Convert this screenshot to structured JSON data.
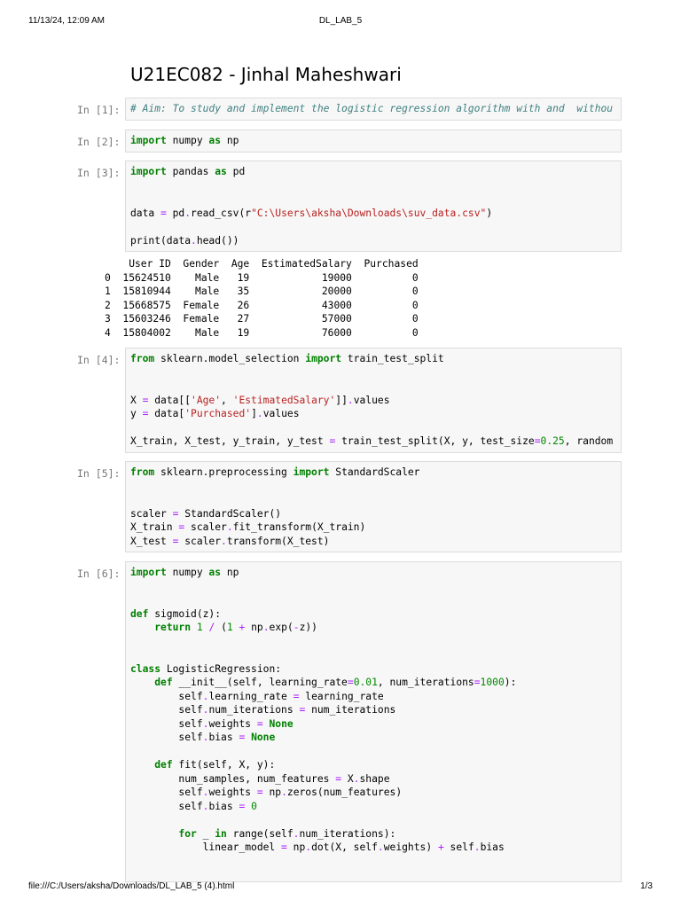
{
  "header": {
    "datetime": "11/13/24, 12:09 AM",
    "doc_title": "DL_LAB_5"
  },
  "footer": {
    "path": "file:///C:/Users/aksha/Downloads/DL_LAB_5 (4).html",
    "page": "1/3"
  },
  "title": "U21EC082 - Jinhal Maheshwari",
  "cells": [
    {
      "prompt": "In [1]:",
      "lines": [
        [
          [
            "c",
            "# Aim: To study and implement the logistic regression algorithm with and  withou"
          ]
        ]
      ]
    },
    {
      "prompt": "In [2]:",
      "lines": [
        [
          [
            "k",
            "import"
          ],
          [
            "p",
            " numpy "
          ],
          [
            "k",
            "as"
          ],
          [
            "p",
            " np"
          ]
        ]
      ]
    },
    {
      "prompt": "In [3]:",
      "lines": [
        [
          [
            "k",
            "import"
          ],
          [
            "p",
            " pandas "
          ],
          [
            "k",
            "as"
          ],
          [
            "p",
            " pd"
          ]
        ],
        [],
        [],
        [
          [
            "p",
            "data "
          ],
          [
            "o",
            "="
          ],
          [
            "p",
            " pd"
          ],
          [
            "o",
            "."
          ],
          [
            "p",
            "read_csv(r"
          ],
          [
            "s",
            "\"C:\\Users\\aksha\\Downloads\\suv_data.csv\""
          ],
          [
            "p",
            ")"
          ]
        ],
        [],
        [
          [
            "p",
            "print(data"
          ],
          [
            "o",
            "."
          ],
          [
            "p",
            "head())"
          ]
        ]
      ],
      "output": [
        "    User ID  Gender  Age  EstimatedSalary  Purchased",
        "0  15624510    Male   19            19000          0",
        "1  15810944    Male   35            20000          0",
        "2  15668575  Female   26            43000          0",
        "3  15603246  Female   27            57000          0",
        "4  15804002    Male   19            76000          0"
      ]
    },
    {
      "prompt": "In [4]:",
      "lines": [
        [
          [
            "k",
            "from"
          ],
          [
            "p",
            " sklearn.model_selection "
          ],
          [
            "k",
            "import"
          ],
          [
            "p",
            " train_test_split"
          ]
        ],
        [],
        [],
        [
          [
            "p",
            "X "
          ],
          [
            "o",
            "="
          ],
          [
            "p",
            " data[["
          ],
          [
            "s",
            "'Age'"
          ],
          [
            "p",
            ", "
          ],
          [
            "s",
            "'EstimatedSalary'"
          ],
          [
            "p",
            "]]"
          ],
          [
            "o",
            "."
          ],
          [
            "p",
            "values"
          ]
        ],
        [
          [
            "p",
            "y "
          ],
          [
            "o",
            "="
          ],
          [
            "p",
            " data["
          ],
          [
            "s",
            "'Purchased'"
          ],
          [
            "p",
            "]"
          ],
          [
            "o",
            "."
          ],
          [
            "p",
            "values"
          ]
        ],
        [],
        [
          [
            "p",
            "X_train, X_test, y_train, y_test "
          ],
          [
            "o",
            "="
          ],
          [
            "p",
            " train_test_split(X, y, test_size"
          ],
          [
            "o",
            "="
          ],
          [
            "n",
            "0.25"
          ],
          [
            "p",
            ", random"
          ]
        ]
      ]
    },
    {
      "prompt": "In [5]:",
      "lines": [
        [
          [
            "k",
            "from"
          ],
          [
            "p",
            " sklearn.preprocessing "
          ],
          [
            "k",
            "import"
          ],
          [
            "p",
            " StandardScaler"
          ]
        ],
        [],
        [],
        [
          [
            "p",
            "scaler "
          ],
          [
            "o",
            "="
          ],
          [
            "p",
            " StandardScaler()"
          ]
        ],
        [
          [
            "p",
            "X_train "
          ],
          [
            "o",
            "="
          ],
          [
            "p",
            " scaler"
          ],
          [
            "o",
            "."
          ],
          [
            "p",
            "fit_transform(X_train)"
          ]
        ],
        [
          [
            "p",
            "X_test "
          ],
          [
            "o",
            "="
          ],
          [
            "p",
            " scaler"
          ],
          [
            "o",
            "."
          ],
          [
            "p",
            "transform(X_test)"
          ]
        ]
      ]
    },
    {
      "prompt": "In [6]:",
      "lines": [
        [
          [
            "k",
            "import"
          ],
          [
            "p",
            " numpy "
          ],
          [
            "k",
            "as"
          ],
          [
            "p",
            " np"
          ]
        ],
        [],
        [],
        [
          [
            "k",
            "def"
          ],
          [
            "p",
            " sigmoid(z):"
          ]
        ],
        [
          [
            "p",
            "    "
          ],
          [
            "k",
            "return"
          ],
          [
            "p",
            " "
          ],
          [
            "n",
            "1"
          ],
          [
            "p",
            " "
          ],
          [
            "o",
            "/"
          ],
          [
            "p",
            " ("
          ],
          [
            "n",
            "1"
          ],
          [
            "p",
            " "
          ],
          [
            "o",
            "+"
          ],
          [
            "p",
            " np"
          ],
          [
            "o",
            "."
          ],
          [
            "p",
            "exp("
          ],
          [
            "o",
            "-"
          ],
          [
            "p",
            "z))"
          ]
        ],
        [],
        [],
        [
          [
            "k",
            "class"
          ],
          [
            "p",
            " LogisticRegression:"
          ]
        ],
        [
          [
            "p",
            "    "
          ],
          [
            "k",
            "def"
          ],
          [
            "p",
            " __init__(self, learning_rate"
          ],
          [
            "o",
            "="
          ],
          [
            "n",
            "0.01"
          ],
          [
            "p",
            ", num_iterations"
          ],
          [
            "o",
            "="
          ],
          [
            "n",
            "1000"
          ],
          [
            "p",
            "):"
          ]
        ],
        [
          [
            "p",
            "        self"
          ],
          [
            "o",
            "."
          ],
          [
            "p",
            "learning_rate "
          ],
          [
            "o",
            "="
          ],
          [
            "p",
            " learning_rate"
          ]
        ],
        [
          [
            "p",
            "        self"
          ],
          [
            "o",
            "."
          ],
          [
            "p",
            "num_iterations "
          ],
          [
            "o",
            "="
          ],
          [
            "p",
            " num_iterations"
          ]
        ],
        [
          [
            "p",
            "        self"
          ],
          [
            "o",
            "."
          ],
          [
            "p",
            "weights "
          ],
          [
            "o",
            "="
          ],
          [
            "p",
            " "
          ],
          [
            "k",
            "None"
          ]
        ],
        [
          [
            "p",
            "        self"
          ],
          [
            "o",
            "."
          ],
          [
            "p",
            "bias "
          ],
          [
            "o",
            "="
          ],
          [
            "p",
            " "
          ],
          [
            "k",
            "None"
          ]
        ],
        [],
        [
          [
            "p",
            "    "
          ],
          [
            "k",
            "def"
          ],
          [
            "p",
            " fit(self, X, y):"
          ]
        ],
        [
          [
            "p",
            "        num_samples, num_features "
          ],
          [
            "o",
            "="
          ],
          [
            "p",
            " X"
          ],
          [
            "o",
            "."
          ],
          [
            "p",
            "shape"
          ]
        ],
        [
          [
            "p",
            "        self"
          ],
          [
            "o",
            "."
          ],
          [
            "p",
            "weights "
          ],
          [
            "o",
            "="
          ],
          [
            "p",
            " np"
          ],
          [
            "o",
            "."
          ],
          [
            "p",
            "zeros(num_features)"
          ]
        ],
        [
          [
            "p",
            "        self"
          ],
          [
            "o",
            "."
          ],
          [
            "p",
            "bias "
          ],
          [
            "o",
            "="
          ],
          [
            "p",
            " "
          ],
          [
            "n",
            "0"
          ]
        ],
        [],
        [
          [
            "p",
            "        "
          ],
          [
            "k",
            "for"
          ],
          [
            "p",
            " _ "
          ],
          [
            "k",
            "in"
          ],
          [
            "p",
            " range(self"
          ],
          [
            "o",
            "."
          ],
          [
            "p",
            "num_iterations):"
          ]
        ],
        [
          [
            "p",
            "            linear_model "
          ],
          [
            "o",
            "="
          ],
          [
            "p",
            " np"
          ],
          [
            "o",
            "."
          ],
          [
            "p",
            "dot(X, self"
          ],
          [
            "o",
            "."
          ],
          [
            "p",
            "weights) "
          ],
          [
            "o",
            "+"
          ],
          [
            "p",
            " self"
          ],
          [
            "o",
            "."
          ],
          [
            "p",
            "bias"
          ]
        ]
      ]
    }
  ]
}
